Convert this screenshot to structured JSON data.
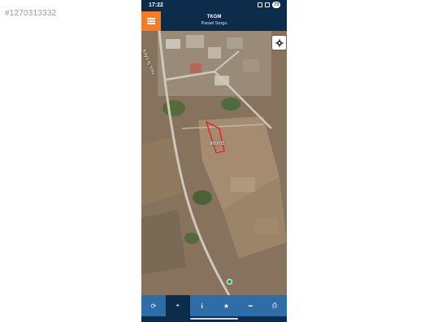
{
  "watermark": "#1270313332",
  "status": {
    "time": "17:22",
    "battery": "73"
  },
  "header": {
    "title": "TKGM",
    "subtitle": "Parsel Sorgu"
  },
  "map": {
    "road_label": "Köyü İç Yolu",
    "parcel_label": "869/05"
  },
  "toolbar": [
    {
      "name": "refresh-icon",
      "glyph": "⟳"
    },
    {
      "name": "locate-icon",
      "glyph": "⌖"
    },
    {
      "name": "info-icon",
      "glyph": "i"
    },
    {
      "name": "favorite-star-icon",
      "glyph": "★"
    },
    {
      "name": "measure-icon",
      "glyph": "━"
    },
    {
      "name": "print-icon",
      "glyph": "⎙"
    }
  ],
  "colors": {
    "header": "#0d2b4a",
    "menu": "#f47b28",
    "toolbar": "#2f6da8",
    "parcel_outline": "#e8202a"
  }
}
